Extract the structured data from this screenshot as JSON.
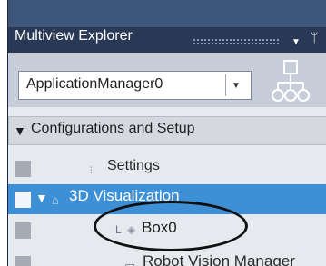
{
  "panel": {
    "title": "Multiview Explorer",
    "dropdown_glyph": "▼",
    "pin_glyph": "ᛘ"
  },
  "toolbar": {
    "selected_application": "ApplicationManager0",
    "select_arrow": "▼",
    "hierarchy_icon": "hierarchy-icon"
  },
  "tree": {
    "section": {
      "expander": "▼",
      "label": "Configurations and Setup"
    },
    "items": [
      {
        "label": "Settings",
        "icon": "settings-icon",
        "icon_glyph": "⫶"
      },
      {
        "label": "3D Visualization",
        "icon": "box-outline-icon",
        "icon_glyph": "⌂",
        "expander": "▼",
        "selected": true
      },
      {
        "label": "Box0",
        "icon": "box-icon",
        "icon_glyph": "◈",
        "elbow": "L"
      },
      {
        "label": "Robot Vision Manager",
        "icon": "robot-vision-icon",
        "icon_glyph": "▭"
      }
    ]
  },
  "colors": {
    "panel_bg": "#293955",
    "selected_row": "#3d8fd6",
    "section_bg": "#d5d9df",
    "tree_bg": "#e6e9ee"
  }
}
